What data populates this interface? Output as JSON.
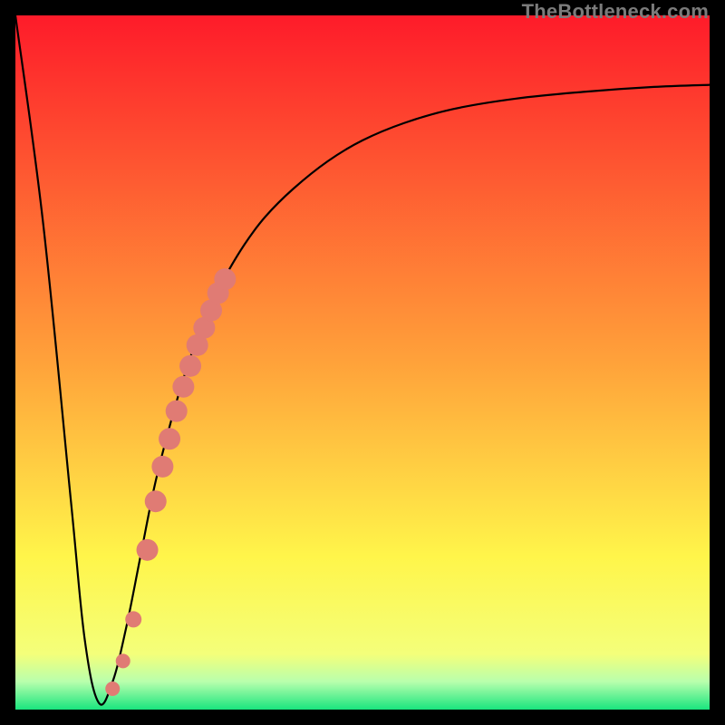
{
  "watermark": {
    "text": "TheBottleneck.com"
  },
  "colors": {
    "gradient_stops": [
      "#fe1b2a",
      "#ffa23a",
      "#fff54a",
      "#f4ff7a",
      "#b8ffad",
      "#19e57e"
    ],
    "curve": "#000000",
    "marker_fill": "#e07b74",
    "frame_bg_border": "#000000"
  },
  "chart_data": {
    "type": "line",
    "title": "",
    "xlabel": "",
    "ylabel": "",
    "xlim": [
      0,
      100
    ],
    "ylim": [
      0,
      100
    ],
    "grid": false,
    "legend": false,
    "series": [
      {
        "name": "bottleneck-curve",
        "comment": "y is implied bottleneck severity (0=none, 100=max). Curve drops from ~100 at x=0 to ~0 near x≈12 then asymptotically rises toward ~90 at x=100.",
        "x": [
          0,
          4,
          8,
          10,
          12,
          14,
          16,
          18,
          20,
          22,
          24,
          26,
          28,
          30,
          33,
          36,
          40,
          45,
          50,
          56,
          63,
          72,
          82,
          92,
          100
        ],
        "y": [
          100,
          70,
          30,
          10,
          1,
          4,
          12,
          22,
          32,
          40,
          47,
          53,
          58,
          62,
          67,
          71,
          75,
          79,
          82,
          84.5,
          86.5,
          88,
          89,
          89.7,
          90
        ]
      }
    ],
    "markers": {
      "name": "highlighted-points",
      "comment": "Pink dot cluster along the rising limb of the curve, roughly x≈14–30.",
      "x": [
        14.0,
        15.5,
        17.0,
        19.0,
        20.2,
        21.2,
        22.2,
        23.2,
        24.2,
        25.2,
        26.2,
        27.2,
        28.2,
        29.2,
        30.2
      ],
      "y": [
        3.0,
        7.0,
        13.0,
        23.0,
        30.0,
        35.0,
        39.0,
        43.0,
        46.5,
        49.5,
        52.5,
        55.0,
        57.5,
        60.0,
        62.0
      ]
    }
  }
}
